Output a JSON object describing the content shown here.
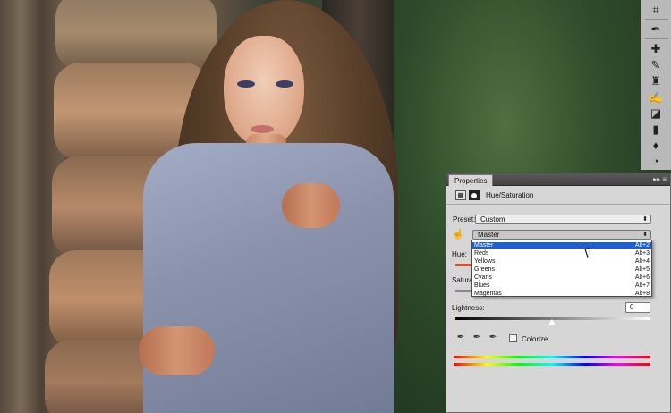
{
  "photo": {
    "subject": "woman-in-sweater"
  },
  "tools": [
    "crop-icon",
    "eyedropper-icon",
    "healing-icon",
    "brush-icon",
    "clone-stamp-icon",
    "history-brush-icon",
    "eraser-icon",
    "gradient-icon",
    "blur-icon",
    "dodge-icon"
  ],
  "panel": {
    "tab_label": "Properties",
    "menu_glyph": "▸▸ ≡",
    "adjustment_title": "Hue/Saturation",
    "preset_label": "Preset:",
    "preset_value": "Custom",
    "channel_value": "Master",
    "hue_label": "Hue:",
    "saturation_label": "Saturat",
    "lightness_label": "Lightness:",
    "lightness_value": "0",
    "colorize_label": "Colorize"
  },
  "dropdown": {
    "items": [
      {
        "label": "Master",
        "shortcut": "Alt+2",
        "selected": true
      },
      {
        "label": "Reds",
        "shortcut": "Alt+3",
        "selected": false
      },
      {
        "label": "Yellows",
        "shortcut": "Alt+4",
        "selected": false
      },
      {
        "label": "Greens",
        "shortcut": "Alt+5",
        "selected": false
      },
      {
        "label": "Cyans",
        "shortcut": "Alt+6",
        "selected": false
      },
      {
        "label": "Blues",
        "shortcut": "Alt+7",
        "selected": false
      },
      {
        "label": "Magentas",
        "shortcut": "Alt+8",
        "selected": false
      }
    ]
  },
  "colors": {
    "panel_bg": "#d6d6d6",
    "selection": "#1a5fd7",
    "header": "#4a4a4a"
  }
}
